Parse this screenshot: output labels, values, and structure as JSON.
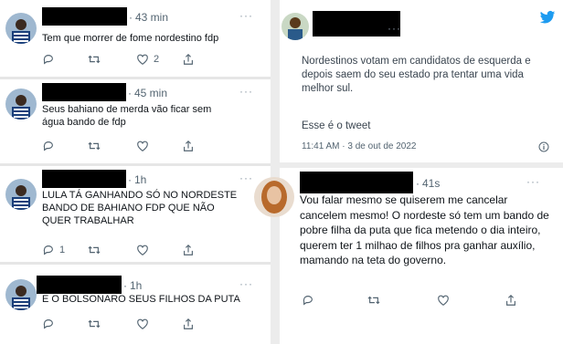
{
  "left_tweets": [
    {
      "time": "43 min",
      "more": "···",
      "lines": [
        "Tem que morrer de fome nordestino fdp"
      ],
      "actions": {
        "reply": "",
        "retweet": "",
        "like": "2",
        "share": ""
      }
    },
    {
      "time": "45 min",
      "more": "···",
      "lines": [
        "Seus bahiano de merda vão ficar sem",
        "água bando de fdp"
      ],
      "actions": {
        "reply": "",
        "retweet": "",
        "like": "",
        "share": ""
      }
    },
    {
      "time": "1h",
      "more": "···",
      "lines": [
        "LULA TÁ GANHANDO SÓ NO NORDESTE",
        "BANDO DE BAHIANO FDP QUE NÃO",
        "QUER TRABALHAR"
      ],
      "actions": {
        "reply": "1",
        "retweet": "",
        "like": "",
        "share": ""
      }
    },
    {
      "time": "1h",
      "more": "···",
      "lines": [
        "E O BOLSONARO SEUS FILHOS DA PUTA"
      ],
      "actions": {
        "reply": "",
        "retweet": "",
        "like": "",
        "share": ""
      }
    }
  ],
  "right_top": {
    "more": "···",
    "lines": [
      "Nordestinos votam em candidatos de esquerda e",
      "depois saem do seu estado pra tentar uma vida",
      "melhor sul."
    ],
    "caption": "Esse é o tweet",
    "timestamp": "11:41 AM · 3 de out de 2022",
    "icons": {
      "brand": "twitter-bird-icon",
      "info": "info-icon"
    },
    "colors": {
      "brand": "#1d9bf0"
    }
  },
  "right_bottom": {
    "time": "41s",
    "more": "···",
    "lines": [
      "Vou falar mesmo se quiserem me cancelar",
      "cancelem mesmo! O nordeste só tem um bando de",
      "pobre filha da puta que fica metendo o dia inteiro,",
      "querem ter 1 milhao de filhos pra ganhar auxílio,",
      "mamando na teta do governo."
    ]
  }
}
